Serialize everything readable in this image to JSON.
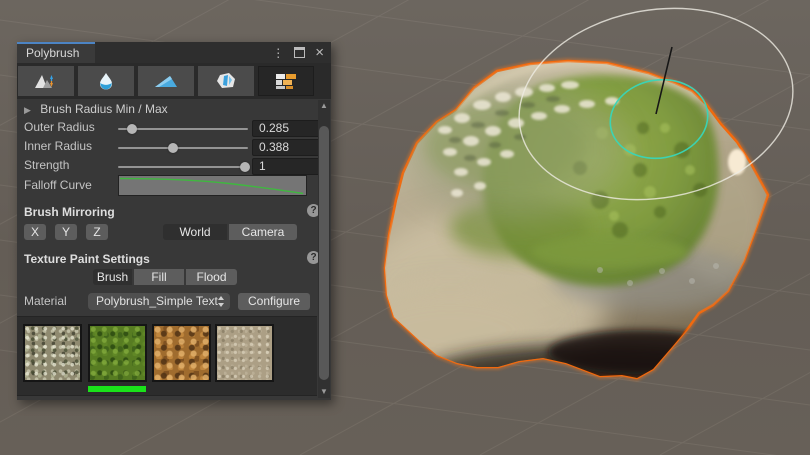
{
  "window": {
    "title": "Polybrush",
    "menu_icon": "⋮",
    "close_icon": "×"
  },
  "icons": {
    "foldout_arrow": "▶",
    "scroll_up": "▲",
    "scroll_down": "▼",
    "help": "?"
  },
  "toolbar": {
    "tools": [
      "sculpt",
      "smooth",
      "paint-colors",
      "scatter-prefabs",
      "paint-textures"
    ],
    "selected_tool": "paint-textures"
  },
  "brush_settings": {
    "foldout_label": "Brush Radius Min / Max",
    "sliders": [
      {
        "label": "Outer Radius",
        "value": "0.285",
        "fraction_pct": "11%"
      },
      {
        "label": "Inner Radius",
        "value": "0.388",
        "fraction_pct": "42%"
      },
      {
        "label": "Strength",
        "value": "1",
        "fraction_pct": "98%"
      }
    ],
    "falloff_label": "Falloff Curve"
  },
  "mirroring": {
    "header": "Brush Mirroring",
    "axes": [
      "X",
      "Y",
      "Z"
    ],
    "spaces": [
      "World",
      "Camera"
    ],
    "selected_space": "World"
  },
  "texture_paint": {
    "header": "Texture Paint Settings",
    "modes": [
      "Brush",
      "Fill",
      "Flood"
    ],
    "selected_mode": "Brush",
    "material_label": "Material",
    "material_value": "Polybrush_Simple Text",
    "configure_label": "Configure"
  },
  "palette": {
    "textures": [
      "gravel",
      "grass",
      "dirt-pebbles",
      "sand"
    ],
    "selected": "grass",
    "selection_color": "#1ae21a"
  },
  "scene": {
    "selection_outline_color": "#f2690d",
    "brush_inner_circle_color": "#38d6b8",
    "brush_outer_circle_color": "#efece4"
  }
}
